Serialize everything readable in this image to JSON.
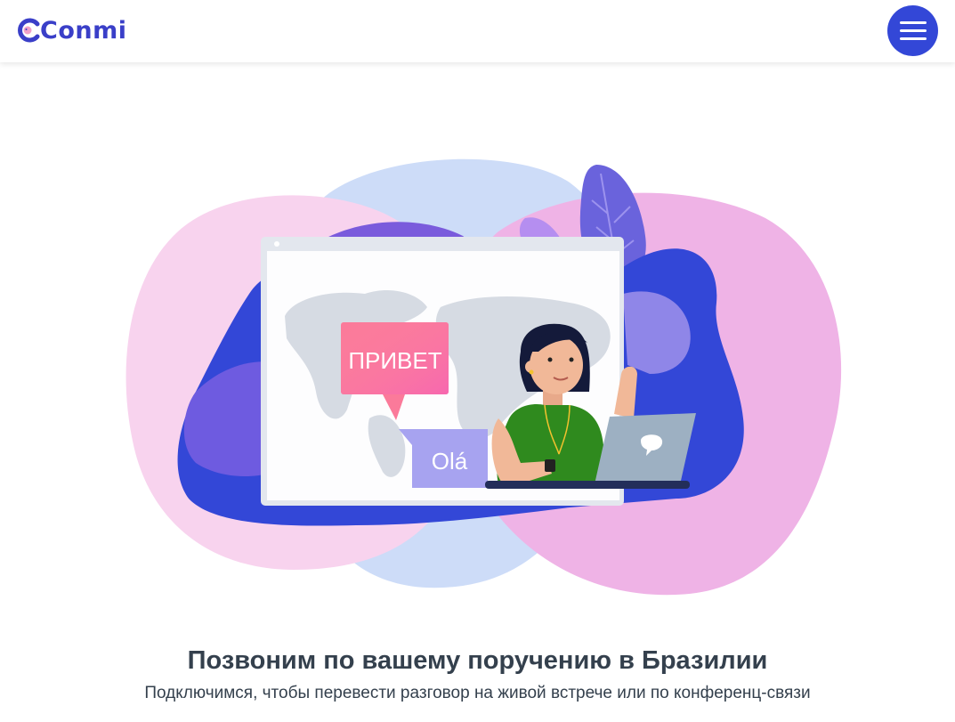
{
  "header": {
    "logo_text": "Conmi",
    "logo_icon": "conmi-logo-icon",
    "menu_icon": "hamburger-menu-icon"
  },
  "hero": {
    "bubble_ru": "ПРИВЕТ",
    "bubble_pt": "Olá"
  },
  "main": {
    "title": "Позвоним по вашему поручению в Бразилии",
    "subtitle": "Подключимся, чтобы перевести разговор на живой встрече или по конференц-связи"
  },
  "colors": {
    "brand": "#3a3fc8",
    "menu_button": "#3347d7",
    "text": "#34404d"
  }
}
